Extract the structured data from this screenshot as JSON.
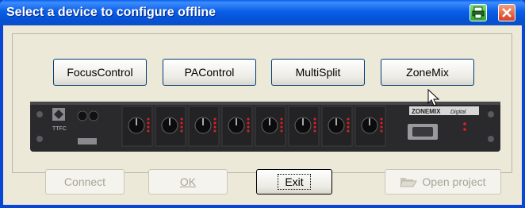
{
  "window": {
    "title": "Select a device to configure offline"
  },
  "device_buttons": [
    {
      "label": "FocusControl"
    },
    {
      "label": "PAControl"
    },
    {
      "label": "MultiSplit"
    },
    {
      "label": "ZoneMix"
    }
  ],
  "device_panel": {
    "brand": "TTFC",
    "model": "ZONEMIX",
    "digital": "Digital"
  },
  "footer": {
    "connect_label": "Connect",
    "ok_label": "OK",
    "exit_label": "Exit",
    "open_project_label": "Open project"
  },
  "colors": {
    "titlebar": "#0a5ee8",
    "frame": "#0846d8",
    "dialog_bg": "#ece9d8",
    "device_bg": "#27272a",
    "led_red": "#e02020"
  },
  "icons": {
    "print": "print-icon",
    "close": "close-icon",
    "open_folder": "folder-open-icon"
  }
}
